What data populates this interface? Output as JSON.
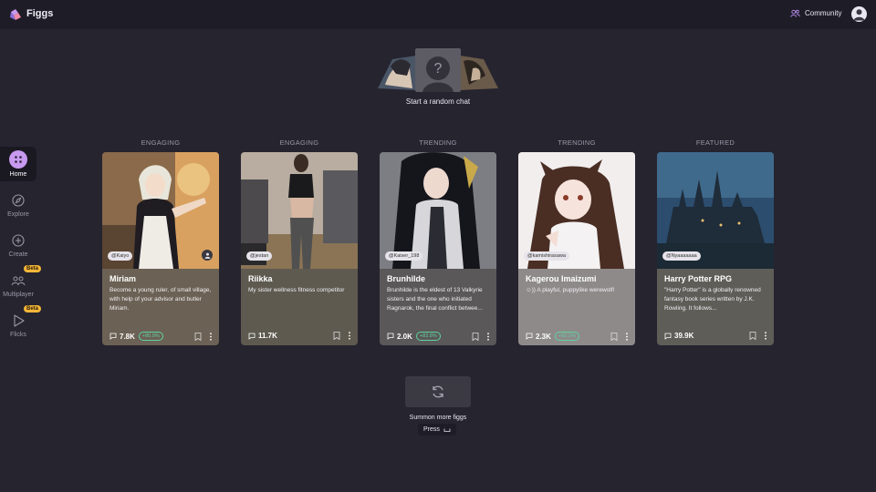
{
  "app": {
    "brand": "Figgs"
  },
  "header": {
    "community_label": "Community"
  },
  "sidebar": {
    "items": [
      {
        "label": "Home"
      },
      {
        "label": "Explore"
      },
      {
        "label": "Create"
      },
      {
        "label": "Multiplayer",
        "badge": "Beta"
      },
      {
        "label": "Flicks",
        "badge": "Beta"
      }
    ]
  },
  "random_chat": {
    "label": "Start a random chat"
  },
  "cards": [
    {
      "category": "ENGAGING",
      "handle": "@Kaiyo",
      "name": "Miriam",
      "description": "Become a young ruler, of small village, with help of your advisor and butler Miriam.",
      "chats": "7.8K",
      "growth": "+80.9%",
      "card_color": "#6b6154"
    },
    {
      "category": "ENGAGING",
      "handle": "@jestan",
      "name": "Riikka",
      "description": "My sister wellness fitness competitor",
      "chats": "11.7K",
      "growth": "",
      "card_color": "#5e5a50"
    },
    {
      "category": "TRENDING",
      "handle": "@Kaiser_198",
      "name": "Brunhilde",
      "description": "Brunhilde is the eldest of 13 Valkyrie sisters and the one who initiated Ragnarok, the final conflict betwee...",
      "chats": "2.0K",
      "growth": "+83.8%",
      "card_color": "#5a5858"
    },
    {
      "category": "TRENDING",
      "handle": "@kamishirasawa",
      "name": "Kagerou Imaizumi",
      "description": "☺)) A playful, puppylike werewolf!",
      "chats": "2.3K",
      "growth": "+92.1%",
      "card_color": "#8e8a8a"
    },
    {
      "category": "FEATURED",
      "handle": "@Nyaaaaaaa",
      "name": "Harry Potter RPG",
      "description": "\"Harry Potter\" is a globally renowned fantasy book series written by J.K. Rowling. It follows...",
      "chats": "39.9K",
      "growth": "",
      "card_color": "#5f5d58"
    }
  ],
  "summon": {
    "label": "Summon more figgs",
    "press_label": "Press"
  }
}
